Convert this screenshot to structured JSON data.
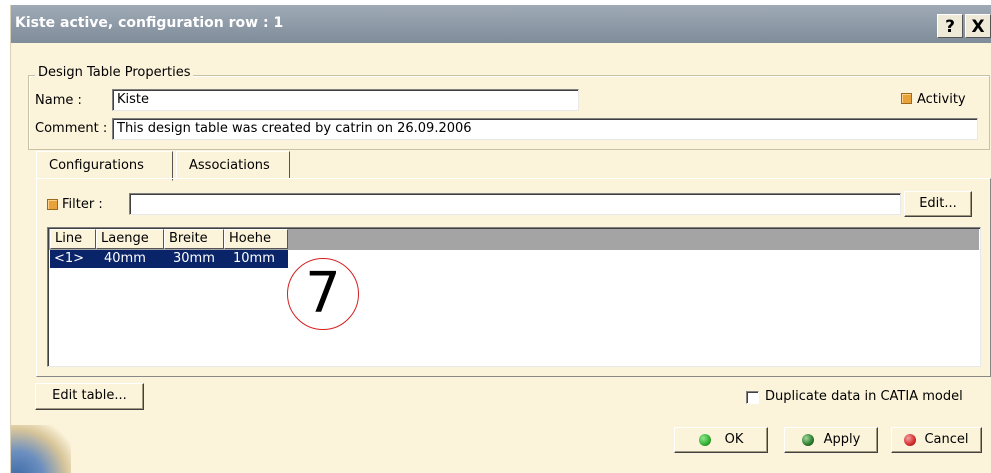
{
  "window": {
    "title": "Kiste active, configuration row : 1",
    "help_label": "?",
    "close_label": "X"
  },
  "properties": {
    "group_title": "Design Table Properties",
    "name_label": "Name :",
    "name_value": "Kiste",
    "comment_label": "Comment :",
    "comment_value": "This design table was created by catrin on 26.09.2006",
    "activity_label": "Activity"
  },
  "tabs": [
    {
      "label": "Configurations",
      "active": true
    },
    {
      "label": "Associations",
      "active": false
    }
  ],
  "filter": {
    "label": "Filter :",
    "value": "",
    "edit_label": "Edit..."
  },
  "table": {
    "columns": [
      "Line",
      "Laenge",
      "Breite",
      "Hoehe"
    ],
    "rows": [
      [
        "<1>",
        "40mm",
        "30mm",
        "10mm"
      ]
    ]
  },
  "annotation": "7",
  "bottom": {
    "edit_table_label": "Edit table...",
    "duplicate_label": "Duplicate data in CATIA model"
  },
  "buttons": {
    "ok": "OK",
    "apply": "Apply",
    "cancel": "Cancel"
  },
  "colors": {
    "dialog_bg": "#fbf3da",
    "title_bar": "#8e99a6",
    "selection": "#0a246a",
    "activity_check": "#e9a23a",
    "ok_dot": "#2fae2f",
    "apply_dot": "#2a7a2a",
    "cancel_dot": "#d42a2a",
    "annotation_circle": "#d42020"
  }
}
